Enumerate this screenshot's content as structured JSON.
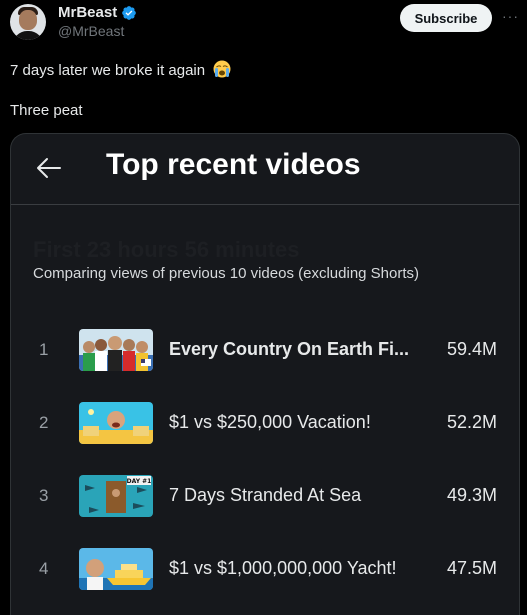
{
  "author": {
    "name": "MrBeast",
    "handle": "@MrBeast",
    "verified_icon": "verified-badge-icon"
  },
  "actions": {
    "subscribe_label": "Subscribe",
    "more_label": "···"
  },
  "tweet": {
    "line1": "7 days later we broke it again",
    "line1_emoji": "loudly-crying-face-icon",
    "line2": "Three peat"
  },
  "card": {
    "title": "Top recent videos",
    "subtitle": "First 23 hours 56 minutes",
    "comparing": "Comparing views of previous 10 videos (excluding Shorts)",
    "videos": [
      {
        "rank": "1",
        "title": "Every Country On Earth Fi...",
        "views": "59.4M"
      },
      {
        "rank": "2",
        "title": "$1 vs $250,000 Vacation!",
        "views": "52.2M"
      },
      {
        "rank": "3",
        "title": "7 Days Stranded At Sea",
        "views": "49.3M",
        "thumb_badge": "DAY #1"
      },
      {
        "rank": "4",
        "title": "$1 vs $1,000,000,000 Yacht!",
        "views": "47.5M"
      }
    ]
  },
  "colors": {
    "background": "#000000",
    "card": "#16181c",
    "verified": "#1d9bf0",
    "muted": "#71767b"
  }
}
